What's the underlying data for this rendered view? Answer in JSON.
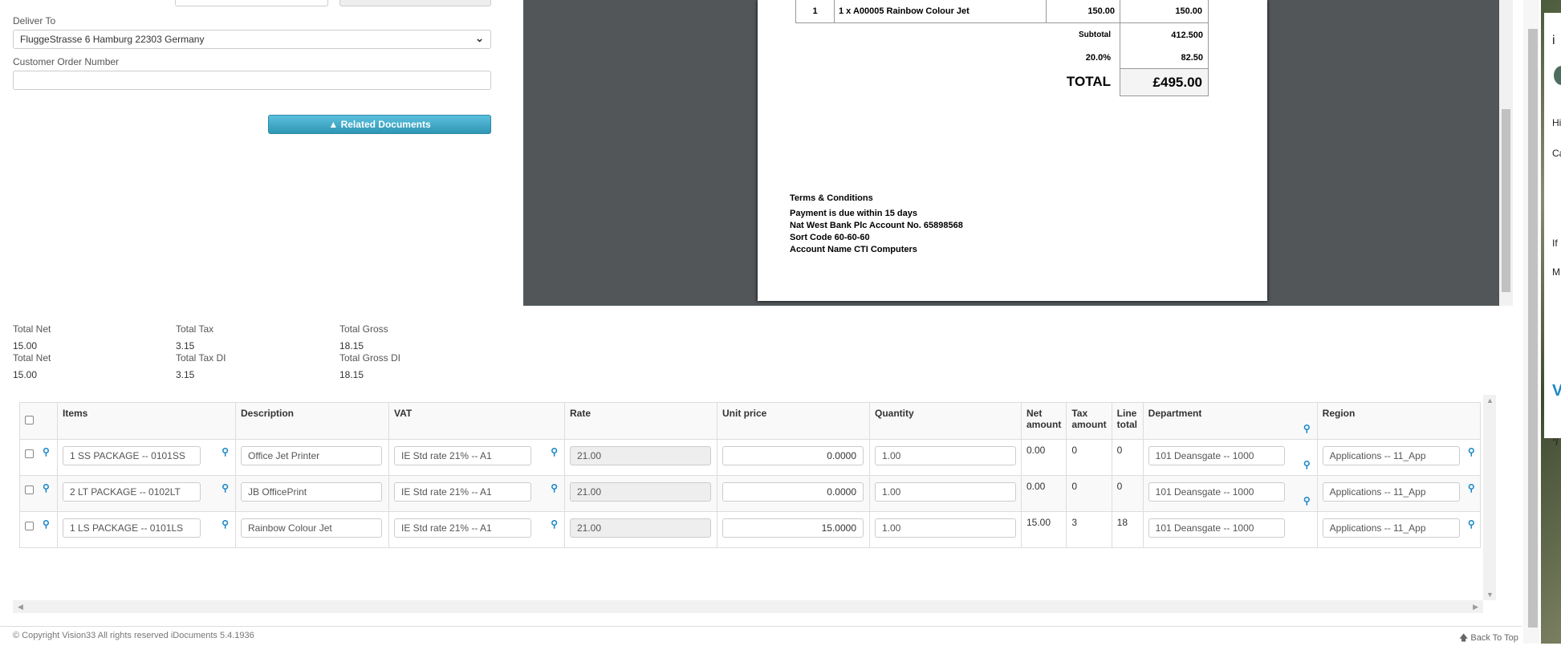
{
  "form": {
    "deliver_to_label": "Deliver To",
    "deliver_to_value": "FluggeStrasse 6 Hamburg 22303 Germany",
    "customer_order_label": "Customer Order Number",
    "customer_order_value": "",
    "related_documents_label": "Related Documents"
  },
  "totals": [
    {
      "label": "Total Net",
      "value": "15.00"
    },
    {
      "label": "Total Tax",
      "value": "3.15"
    },
    {
      "label": "Total Gross",
      "value": "18.15"
    },
    {
      "label": "Total Net",
      "value": "15.00"
    },
    {
      "label": "Total Tax DI",
      "value": "3.15"
    },
    {
      "label": "Total Gross DI",
      "value": "18.15"
    }
  ],
  "invoice": {
    "line": {
      "no": "1",
      "description": "1 x A00005 Rainbow Colour Jet",
      "price": "150.00",
      "total": "150.00"
    },
    "subtotal_label": "Subtotal",
    "subtotal_value": "412.500",
    "tax_label": "20.0%",
    "tax_value": "82.50",
    "total_label": "TOTAL",
    "total_value": "£495.00",
    "terms_title": "Terms & Conditions",
    "terms_lines": [
      "Payment is due within 15 days",
      "Nat West Bank Plc Account No. 65898568",
      "Sort Code 60-60-60",
      "Account Name CTI Computers"
    ]
  },
  "grid": {
    "headers": [
      "Items",
      "Description",
      "VAT",
      "Rate",
      "Unit price",
      "Quantity",
      "Net amount",
      "Tax amount",
      "Line total",
      "Department",
      "Region"
    ],
    "rows": [
      {
        "item": "1 SS PACKAGE -- 0101SS",
        "description": "Office Jet Printer",
        "vat": "IE Std rate 21% -- A1",
        "rate": "21.00",
        "unit_price": "0.0000",
        "quantity": "1.00",
        "net": "0.00",
        "tax": "0",
        "line_total": "0",
        "department": "101 Deansgate -- 1000",
        "region": "Applications -- 11_App"
      },
      {
        "item": "2 LT PACKAGE -- 0102LT",
        "description": "JB OfficePrint",
        "vat": "IE Std rate 21% -- A1",
        "rate": "21.00",
        "unit_price": "0.0000",
        "quantity": "1.00",
        "net": "0.00",
        "tax": "0",
        "line_total": "0",
        "department": "101 Deansgate -- 1000",
        "region": "Applications -- 11_App"
      },
      {
        "item": "1 LS PACKAGE -- 0101LS",
        "description": "Rainbow Colour Jet",
        "vat": "IE Std rate 21% -- A1",
        "rate": "21.00",
        "unit_price": "15.0000",
        "quantity": "1.00",
        "net": "15.00",
        "tax": "3",
        "line_total": "18",
        "department": "101 Deansgate -- 1000",
        "region": "Applications -- 11_App"
      }
    ]
  },
  "footer": {
    "copyright": "© Copyright Vision33 All rights reserved iDocuments 5.4.1936",
    "back_to_top": "Back To Top"
  },
  "colors": {
    "accent": "#1a87c8",
    "button": "#3aa8c9",
    "viewer_bg": "#525659"
  }
}
